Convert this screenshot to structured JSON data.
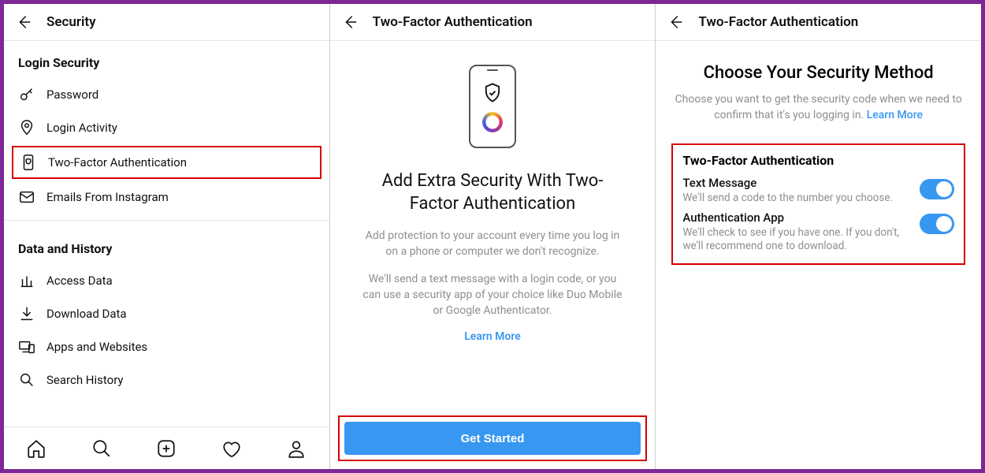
{
  "panel1": {
    "title": "Security",
    "section_login": "Login Security",
    "rows_login": [
      {
        "label": "Password",
        "icon": "key-icon"
      },
      {
        "label": "Login Activity",
        "icon": "location-icon"
      },
      {
        "label": "Two-Factor Authentication",
        "icon": "shield-phone-icon",
        "highlighted": true
      },
      {
        "label": "Emails From Instagram",
        "icon": "mail-icon"
      }
    ],
    "section_data": "Data and History",
    "rows_data": [
      {
        "label": "Access Data",
        "icon": "chart-icon"
      },
      {
        "label": "Download Data",
        "icon": "download-icon"
      },
      {
        "label": "Apps and Websites",
        "icon": "devices-icon"
      },
      {
        "label": "Search History",
        "icon": "search-icon"
      }
    ],
    "nav": [
      "home-icon",
      "search-icon",
      "add-icon",
      "activity-icon",
      "profile-icon"
    ]
  },
  "panel2": {
    "title": "Two-Factor Authentication",
    "big_title": "Add Extra Security With Two-Factor Authentication",
    "para1": "Add protection to your account every time you log in on a phone or computer we don't recognize.",
    "para2": "We'll send a text message with a login code, or you can use a security app of your choice like Duo Mobile or Google Authenticator.",
    "learn_more": "Learn More",
    "cta": "Get Started"
  },
  "panel3": {
    "title": "Two-Factor Authentication",
    "heading": "Choose Your Security Method",
    "sub_pre": "Choose you want to get the security code when we need to confirm that it's you logging in. ",
    "learn_more": "Learn More",
    "box_heading": "Two-Factor Authentication",
    "methods": [
      {
        "label": "Text Message",
        "desc": "We'll send a code to the number you choose.",
        "on": true
      },
      {
        "label": "Authentication App",
        "desc": "We'll check to see if you have one. If you don't, we'll recommend one to download.",
        "on": true
      }
    ]
  }
}
